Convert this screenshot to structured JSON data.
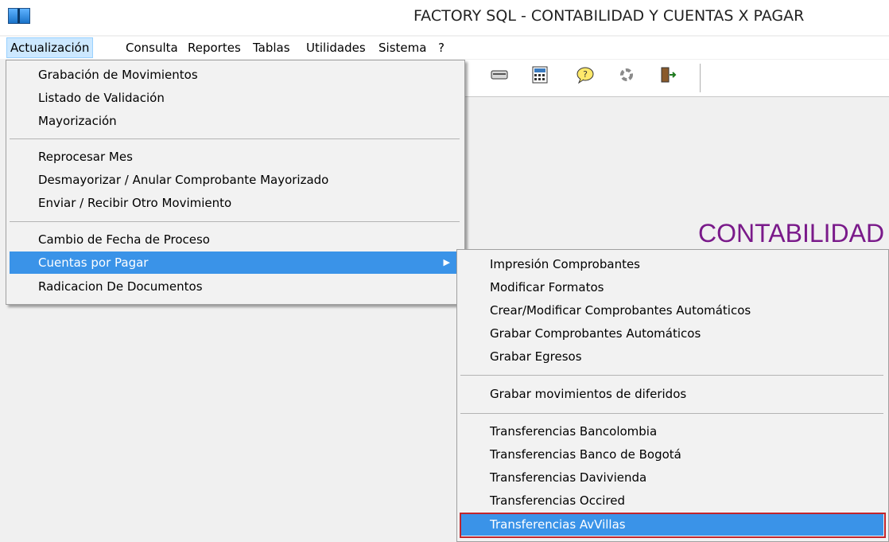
{
  "window": {
    "title": "FACTORY SQL - CONTABILIDAD Y CUENTAS X PAGAR"
  },
  "menubar": [
    {
      "label": "Actualización",
      "active": true
    },
    {
      "label": "Consulta"
    },
    {
      "label": "Reportes"
    },
    {
      "label": "Tablas"
    },
    {
      "label": "Utilidades"
    },
    {
      "label": "Sistema"
    },
    {
      "label": "?"
    }
  ],
  "toolbar": {
    "icons": [
      "keyboard-icon",
      "calculator-icon",
      "help-icon",
      "refresh-icon",
      "exit-icon"
    ]
  },
  "main_menu": {
    "items": [
      "Grabación de Movimientos",
      "Listado de Validación",
      "Mayorización",
      "Reprocesar Mes",
      "Desmayorizar / Anular Comprobante Mayorizado",
      "Enviar  / Recibir Otro Movimiento",
      "Cambio de Fecha de Proceso",
      "Cuentas por Pagar",
      "Radicacion De Documentos"
    ],
    "highlighted": "Cuentas por Pagar"
  },
  "submenu": {
    "items": [
      "Impresión Comprobantes",
      "Modificar Formatos",
      "Crear/Modificar Comprobantes Automáticos",
      "Grabar Comprobantes Automáticos",
      "Grabar Egresos",
      "Grabar movimientos de diferidos",
      "Transferencias Bancolombia",
      "Transferencias Banco de Bogotá",
      "Transferencias Davivienda",
      "Transferencias Occired",
      "Transferencias AvVillas"
    ],
    "highlighted": "Transferencias AvVillas"
  },
  "workarea": {
    "title": "CONTABILIDAD"
  },
  "colors": {
    "highlight": "#3a93e8",
    "accent_purple": "#7a1a8a",
    "annotation_red": "#c0262d"
  }
}
